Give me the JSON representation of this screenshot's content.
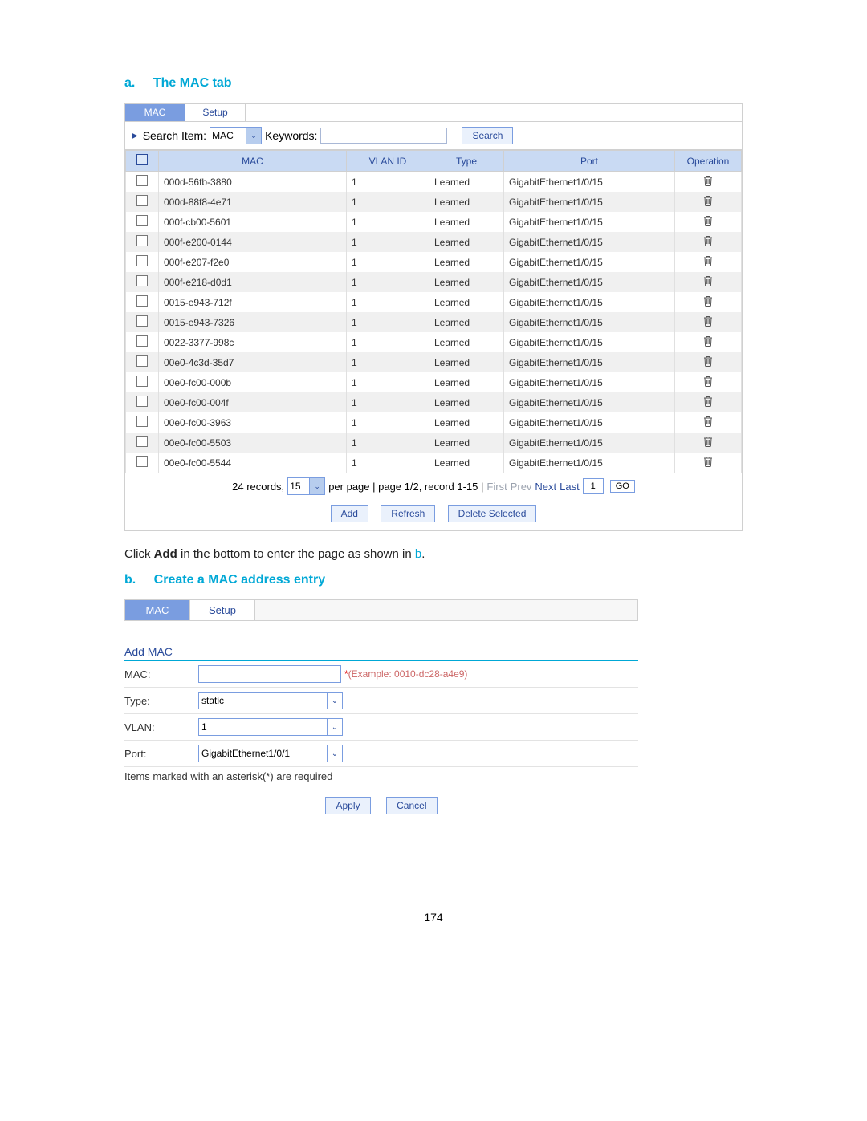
{
  "headingA": {
    "letter": "a.",
    "title": "The MAC tab"
  },
  "tabsA": {
    "mac": "MAC",
    "setup": "Setup"
  },
  "search": {
    "item_label": "Search Item:",
    "item_value": "MAC",
    "keywords_label": "Keywords:",
    "keywords_value": "",
    "button": "Search"
  },
  "tableHeaders": {
    "mac": "MAC",
    "vlan": "VLAN ID",
    "type": "Type",
    "port": "Port",
    "op": "Operation"
  },
  "rows": [
    {
      "mac": "000d-56fb-3880",
      "vlan": "1",
      "type": "Learned",
      "port": "GigabitEthernet1/0/15"
    },
    {
      "mac": "000d-88f8-4e71",
      "vlan": "1",
      "type": "Learned",
      "port": "GigabitEthernet1/0/15"
    },
    {
      "mac": "000f-cb00-5601",
      "vlan": "1",
      "type": "Learned",
      "port": "GigabitEthernet1/0/15"
    },
    {
      "mac": "000f-e200-0144",
      "vlan": "1",
      "type": "Learned",
      "port": "GigabitEthernet1/0/15"
    },
    {
      "mac": "000f-e207-f2e0",
      "vlan": "1",
      "type": "Learned",
      "port": "GigabitEthernet1/0/15"
    },
    {
      "mac": "000f-e218-d0d1",
      "vlan": "1",
      "type": "Learned",
      "port": "GigabitEthernet1/0/15"
    },
    {
      "mac": "0015-e943-712f",
      "vlan": "1",
      "type": "Learned",
      "port": "GigabitEthernet1/0/15"
    },
    {
      "mac": "0015-e943-7326",
      "vlan": "1",
      "type": "Learned",
      "port": "GigabitEthernet1/0/15"
    },
    {
      "mac": "0022-3377-998c",
      "vlan": "1",
      "type": "Learned",
      "port": "GigabitEthernet1/0/15"
    },
    {
      "mac": "00e0-4c3d-35d7",
      "vlan": "1",
      "type": "Learned",
      "port": "GigabitEthernet1/0/15"
    },
    {
      "mac": "00e0-fc00-000b",
      "vlan": "1",
      "type": "Learned",
      "port": "GigabitEthernet1/0/15"
    },
    {
      "mac": "00e0-fc00-004f",
      "vlan": "1",
      "type": "Learned",
      "port": "GigabitEthernet1/0/15"
    },
    {
      "mac": "00e0-fc00-3963",
      "vlan": "1",
      "type": "Learned",
      "port": "GigabitEthernet1/0/15"
    },
    {
      "mac": "00e0-fc00-5503",
      "vlan": "1",
      "type": "Learned",
      "port": "GigabitEthernet1/0/15"
    },
    {
      "mac": "00e0-fc00-5544",
      "vlan": "1",
      "type": "Learned",
      "port": "GigabitEthernet1/0/15"
    }
  ],
  "pager": {
    "records": "24 records,",
    "perpage_value": "15",
    "perpage_tail": "per page | page 1/2, record 1-15 |",
    "first": "First",
    "prev": "Prev",
    "next": "Next",
    "last": "Last",
    "page_input": "1",
    "go": "GO"
  },
  "footerButtons": {
    "add": "Add",
    "refresh": "Refresh",
    "deletesel": "Delete Selected"
  },
  "instruction": {
    "pre": "Click ",
    "bold": "Add",
    "post": " in the bottom to enter the page as shown in ",
    "ref": "b",
    "dot": "."
  },
  "headingB": {
    "letter": "b.",
    "title": "Create a MAC address entry"
  },
  "tabsB": {
    "mac": "MAC",
    "setup": "Setup"
  },
  "formB": {
    "title": "Add MAC",
    "mac_label": "MAC:",
    "mac_value": "",
    "example": "(Example: 0010-dc28-a4e9)",
    "type_label": "Type:",
    "type_value": "static",
    "vlan_label": "VLAN:",
    "vlan_value": "1",
    "port_label": "Port:",
    "port_value": "GigabitEthernet1/0/1",
    "reqnote": "Items marked with an asterisk(*) are required",
    "apply": "Apply",
    "cancel": "Cancel"
  },
  "page_number": "174"
}
